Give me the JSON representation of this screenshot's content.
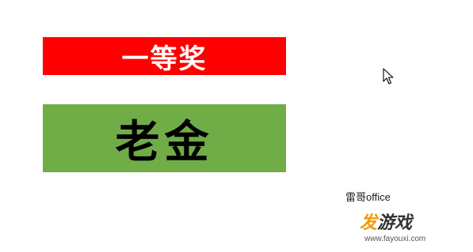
{
  "award_banner": {
    "text": "一等奖",
    "background_color": "#ff0000",
    "text_color": "#ffffff"
  },
  "name_card": {
    "text": "老金",
    "background_color": "#70ad47",
    "text_color": "#000000"
  },
  "cursor": {
    "icon": "mouse-pointer-arrow"
  },
  "author_mark": {
    "text": "雷哥office"
  },
  "watermark": {
    "logo_first": "发",
    "logo_rest": "游戏",
    "url": "www.fayouxi.com",
    "accent_color": "#f39800"
  }
}
